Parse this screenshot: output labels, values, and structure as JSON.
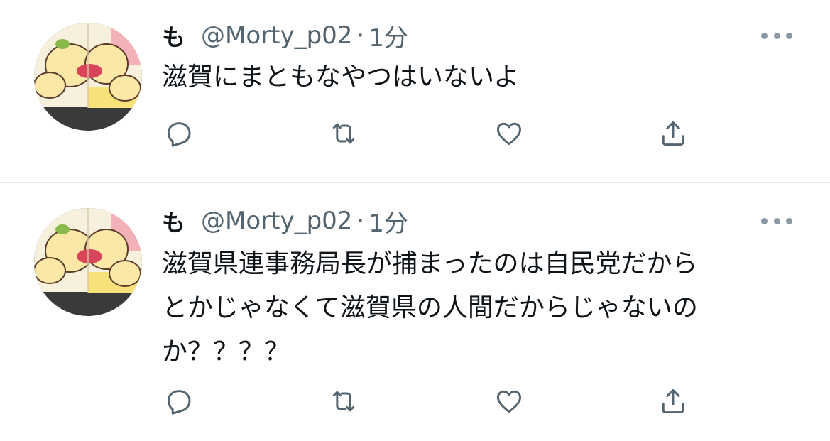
{
  "colors": {
    "text": "#0f1419",
    "secondary": "#536471",
    "icon": "#536471",
    "divider": "#e1e8ed",
    "background": "#ffffff"
  },
  "icons": {
    "reply": "reply-icon",
    "retweet": "retweet-icon",
    "like": "heart-icon",
    "share": "share-icon",
    "more": "more-icon"
  },
  "tweets": [
    {
      "display_name": "も",
      "handle": "@Morty_p02",
      "separator": "·",
      "time": "1分",
      "text": "滋賀にまともなやつはいないよ"
    },
    {
      "display_name": "も",
      "handle": "@Morty_p02",
      "separator": "·",
      "time": "1分",
      "text": "滋賀県連事務局長が捕まったのは自民党だから\nとかじゃなくて滋賀県の人間だからじゃないの\nか？？？？"
    }
  ]
}
